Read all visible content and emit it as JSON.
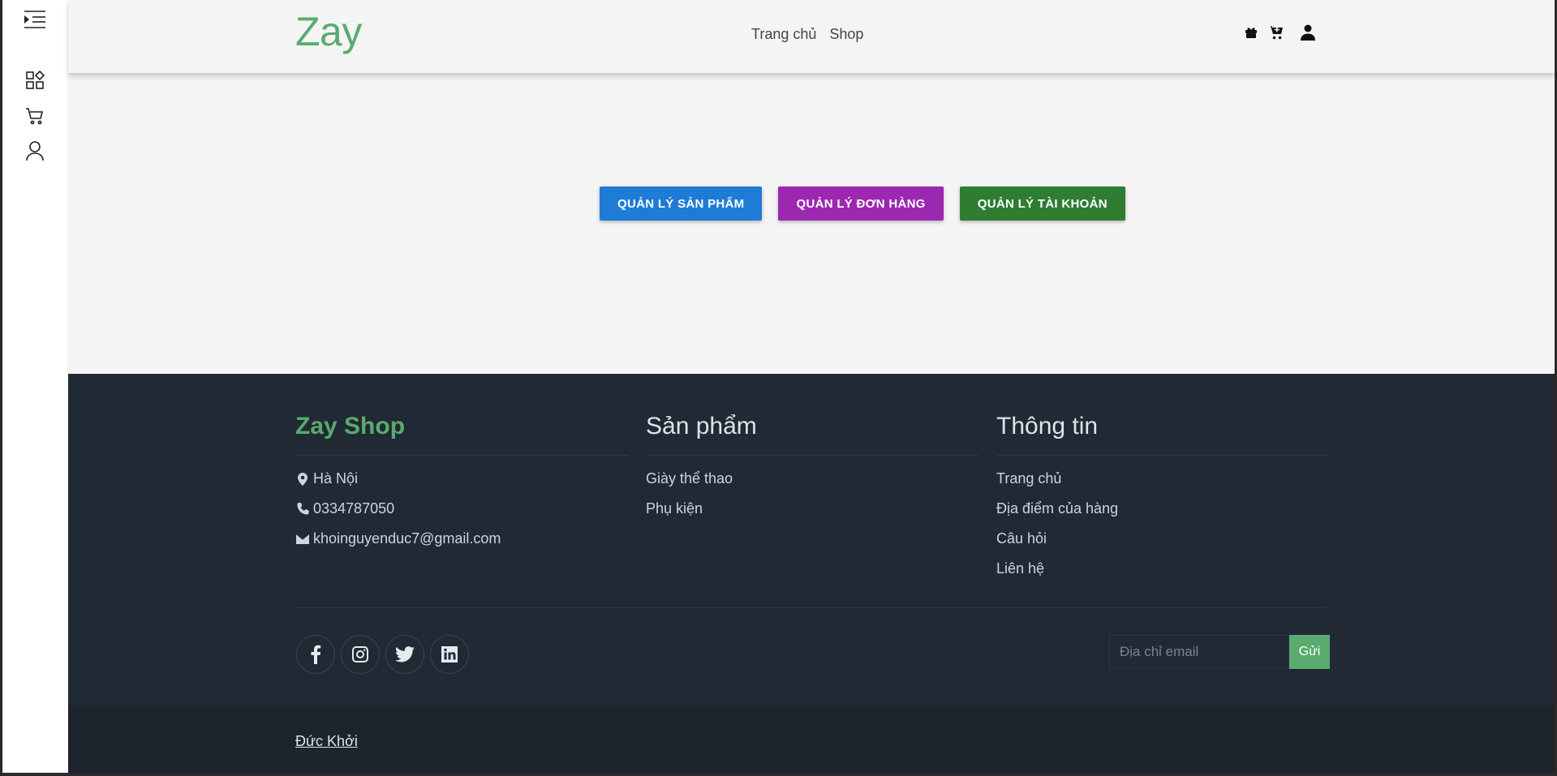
{
  "sidebar": {
    "items": [
      {
        "icon": "menu-indent-icon"
      },
      {
        "icon": "dashboard-icon"
      },
      {
        "icon": "cart-icon"
      },
      {
        "icon": "user-icon"
      }
    ]
  },
  "header": {
    "brand": "Zay",
    "nav": [
      {
        "label": "Trang chủ"
      },
      {
        "label": "Shop"
      }
    ],
    "icons": [
      "gift-icon",
      "cart-icon",
      "user-icon"
    ]
  },
  "main": {
    "buttons": [
      {
        "label": "QUẢN LÝ SẢN PHẨM",
        "color": "#1e7bd6"
      },
      {
        "label": "QUẢN LÝ ĐƠN HÀNG",
        "color": "#9c27b0"
      },
      {
        "label": "QUẢN LÝ TÀI KHOẢN",
        "color": "#2e7d32"
      }
    ]
  },
  "footer": {
    "col1": {
      "title": "Zay Shop",
      "items": [
        {
          "icon": "map-pin-icon",
          "text": "Hà Nội"
        },
        {
          "icon": "phone-icon",
          "text": "0334787050"
        },
        {
          "icon": "envelope-icon",
          "text": "khoinguyenduc7@gmail.com"
        }
      ]
    },
    "col2": {
      "title": "Sản phẩm",
      "items": [
        "Giày thể thao",
        "Phụ kiện"
      ]
    },
    "col3": {
      "title": "Thông tin",
      "items": [
        "Trang chủ",
        "Địa điểm của hàng",
        "Câu hỏi",
        "Liên hệ"
      ]
    },
    "socials": [
      "facebook-icon",
      "instagram-icon",
      "twitter-icon",
      "linkedin-icon"
    ],
    "subscribe": {
      "placeholder": "Địa chỉ email",
      "button": "Gửi"
    },
    "author": "Đức Khởi"
  },
  "colors": {
    "brand": "#59ab6e",
    "footer_bg": "#212934",
    "footer_bottom_bg": "#1d242d"
  }
}
